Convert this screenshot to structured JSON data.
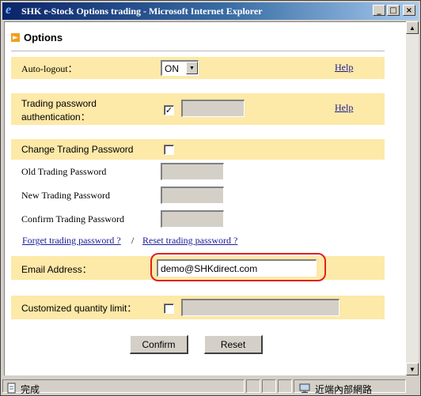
{
  "window": {
    "title": "SHK e-Stock Options trading - Microsoft Internet Explorer",
    "buttons": {
      "minimize": "_",
      "maximize": "□",
      "close": "×"
    }
  },
  "page": {
    "heading": "Options",
    "auto_logout": {
      "label": "Auto-logout：",
      "selected": "ON",
      "help": "Help"
    },
    "trading_password_auth": {
      "label_line1": "Trading password",
      "label_line2": "authentication：",
      "checked": true,
      "help": "Help"
    },
    "change_password": {
      "label": "Change Trading Password",
      "checked": false,
      "old_label": "Old Trading Password",
      "new_label": "New Trading Password",
      "confirm_label": "Confirm Trading Password"
    },
    "links": {
      "forget": "Forget trading password ?",
      "separator": "/",
      "reset": "Reset trading password ?"
    },
    "email": {
      "label": "Email Address：",
      "value": "demo@SHKdirect.com"
    },
    "quantity_limit": {
      "label": "Customized quantity limit：",
      "checked": false
    },
    "actions": {
      "confirm": "Confirm",
      "reset": "Reset"
    }
  },
  "statusbar": {
    "status": "完成",
    "zone": "近端內部網路"
  },
  "colors": {
    "band": "#fde9a8",
    "highlight": "#e02020",
    "link": "#1a1a9a",
    "titlebar": "#0a246a"
  },
  "icons": [
    "ie-logo-icon",
    "arrow-right-icon",
    "chevron-down-icon",
    "check-icon",
    "page-icon",
    "zone-icon"
  ]
}
